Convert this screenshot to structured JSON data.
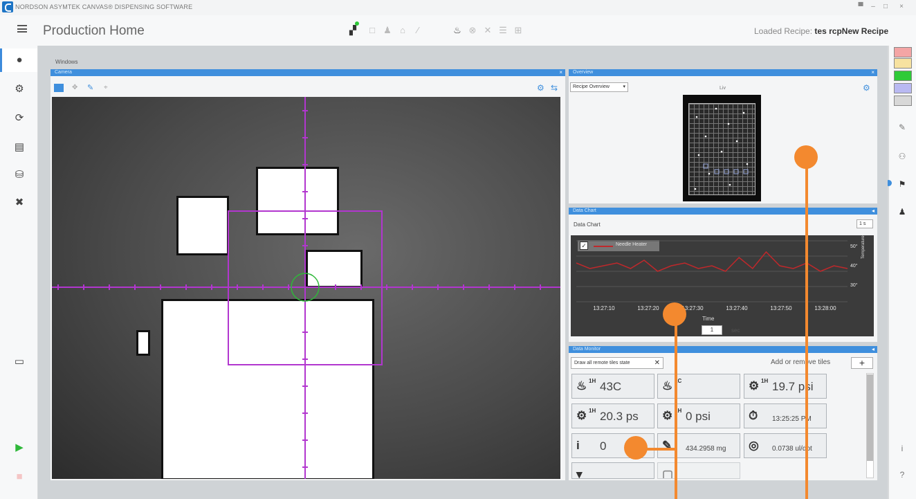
{
  "window": {
    "title": "NORDSON ASYMTEK CANVAS® DISPENSING SOFTWARE",
    "controls": [
      "▀",
      "–",
      "□",
      "×"
    ]
  },
  "header": {
    "title": "Production Home",
    "loaded_recipe_label": "Loaded Recipe:",
    "loaded_recipe_value": "tes rcpNew Recipe"
  },
  "main": {
    "section_label": "Windows"
  },
  "camera": {
    "title": "Camera"
  },
  "overview": {
    "title": "Overview",
    "dropdown": "Recipe Overview",
    "label": "Liv"
  },
  "chart": {
    "title": "Data Chart",
    "subtitle": "Data Chart",
    "dropdown": "1 s",
    "legend": "Needle Heater",
    "xlabel": "Time",
    "ylabel": "Temperature",
    "footer_values": [
      "1",
      "sec"
    ],
    "colors": {
      "series": "#c0282b",
      "background": "#3b3b3b"
    },
    "chart_data": {
      "type": "line",
      "x": [
        "13:27:10",
        "13:27:20",
        "13:27:30",
        "13:27:40",
        "13:27:50",
        "13:28:00"
      ],
      "series": [
        {
          "name": "Needle Heater",
          "values": [
            44,
            42,
            43,
            44,
            42,
            45,
            41,
            43,
            44,
            42,
            43,
            41,
            46,
            42,
            48,
            43,
            42,
            44,
            41,
            43,
            42
          ]
        }
      ],
      "ytick_labels": [
        "50°",
        "40°",
        "30°"
      ]
    }
  },
  "monitor": {
    "title": "Data Monitor",
    "filter_chip": "Draw all remote tiles state",
    "add_remove": "Add or remove tiles",
    "tiles": [
      {
        "icon": "heater-1h-icon",
        "glyph": "♨",
        "sub": "1H",
        "value": "43C"
      },
      {
        "icon": "heater-1c-icon",
        "glyph": "♨",
        "sub": "1C",
        "value": ""
      },
      {
        "icon": "pressure-1h-icon",
        "glyph": "⚙",
        "sub": "1H",
        "value": "19.7 psi"
      },
      {
        "icon": "pressure-1h-alt-icon",
        "glyph": "⚙",
        "sub": "1H",
        "value": "20.3 ps"
      },
      {
        "icon": "pressure-1h-zero-icon",
        "glyph": "⚙",
        "sub": "1H",
        "value": "0 psi"
      },
      {
        "icon": "clock-icon",
        "glyph": "⏱",
        "sub": "",
        "value": "13:25:25 PM"
      },
      {
        "icon": "info-icon",
        "glyph": "i",
        "sub": "",
        "value": "0"
      },
      {
        "icon": "syringe-icon",
        "glyph": "✎",
        "sub": "",
        "value": "434.2958 mg"
      },
      {
        "icon": "target-icon",
        "glyph": "◎",
        "sub": "",
        "value": "0.0738 ul/dot"
      },
      {
        "icon": "nozzle-icon",
        "glyph": "▾",
        "sub": "",
        "value": ""
      },
      {
        "icon": "valve-icon",
        "glyph": "▢",
        "sub": "",
        "value": ""
      }
    ]
  },
  "signals": {
    "colors": [
      "#f4a5a5",
      "#f7e2a0",
      "#2fca38",
      "#b9b9f2",
      "#d8d8d8"
    ]
  }
}
